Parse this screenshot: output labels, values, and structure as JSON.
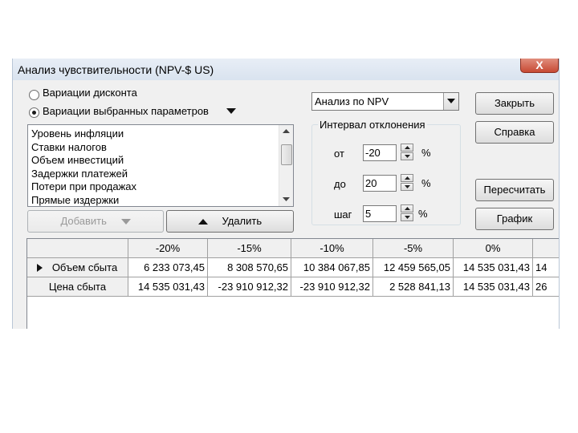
{
  "window": {
    "title": "Анализ чувствительности (NPV-$ US)",
    "close_glyph": "X"
  },
  "options": {
    "radio_discount": "Вариации дисконта",
    "radio_params": "Вариации выбранных параметров"
  },
  "params_list": [
    "Уровень инфляции",
    "Ставки налогов",
    "Объем инвестиций",
    "Задержки платежей",
    "Потери при продажах",
    "Прямые издержки"
  ],
  "buttons": {
    "add": "Добавить",
    "delete": "Удалить",
    "close": "Закрыть",
    "help": "Справка",
    "recalc": "Пересчитать",
    "graph": "График"
  },
  "analysis_select": {
    "value": "Анализ по NPV"
  },
  "interval": {
    "title": "Интервал отклонения",
    "from_label": "от",
    "from_value": "-20",
    "to_label": "до",
    "to_value": "20",
    "step_label": "шаг",
    "step_value": "5",
    "percent": "%"
  },
  "table": {
    "columns": [
      "-20%",
      "-15%",
      "-10%",
      "-5%",
      "0%",
      ""
    ],
    "rows": [
      {
        "label": "Объем сбыта",
        "values": [
          "6 233 073,45",
          "8 308 570,65",
          "10 384 067,85",
          "12 459 565,05",
          "14 535 031,43",
          "14"
        ]
      },
      {
        "label": "Цена сбыта",
        "values": [
          "14 535 031,43",
          "-23 910 912,32",
          "-23 910 912,32",
          "2 528 841,13",
          "14 535 031,43",
          "26"
        ]
      }
    ]
  }
}
